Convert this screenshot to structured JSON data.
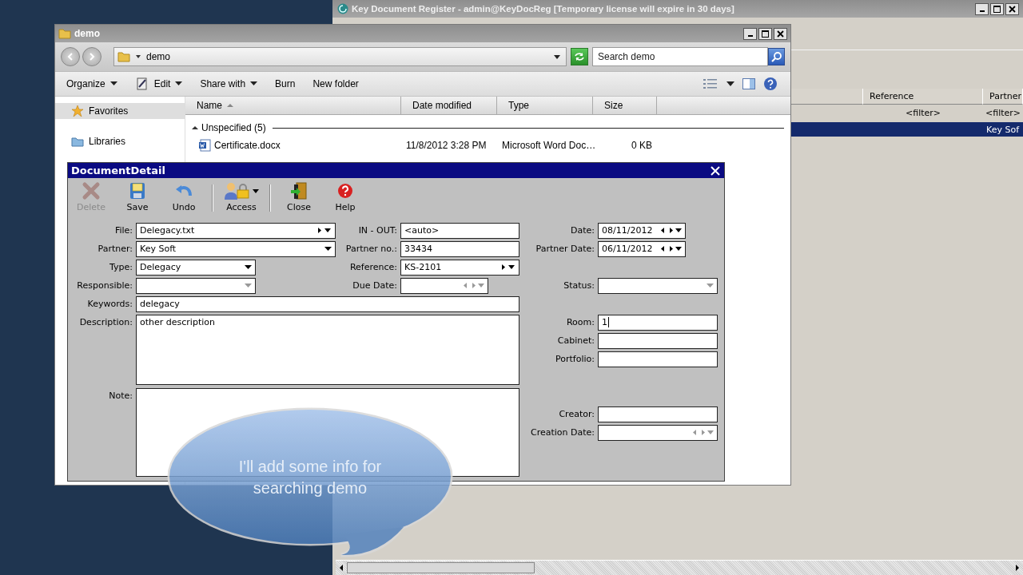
{
  "background_window": {
    "title": "Key Document Register - admin@KeyDocReg [Temporary license will expire in 30 days]",
    "table": {
      "columns": [
        {
          "label": "Reference"
        },
        {
          "label": "Partner"
        }
      ],
      "filters": [
        "<filter>",
        "<filter>"
      ],
      "rows": [
        {
          "partner": "Key Sof",
          "selected": true
        }
      ]
    }
  },
  "explorer": {
    "title": "demo",
    "address": "demo",
    "search": {
      "placeholder": "Search demo"
    },
    "toolbar": [
      {
        "label": "Organize",
        "kind": "menu"
      },
      {
        "label": "Edit",
        "kind": "icon-menu"
      },
      {
        "label": "Share with",
        "kind": "menu"
      },
      {
        "label": "Burn",
        "kind": "command"
      },
      {
        "label": "New folder",
        "kind": "command"
      }
    ],
    "nav": [
      {
        "label": "Favorites",
        "kind": "favorites",
        "selected": true
      },
      {
        "label": "Libraries",
        "kind": "libraries",
        "selected": false
      }
    ],
    "columns": [
      {
        "label": "Name",
        "sorted": true
      },
      {
        "label": "Date modified",
        "sorted": false
      },
      {
        "label": "Type",
        "sorted": false
      },
      {
        "label": "Size",
        "sorted": false
      }
    ],
    "group": {
      "label": "Unspecified (5)",
      "expanded": true
    },
    "files": [
      {
        "name": "Certificate.docx",
        "date": "11/8/2012 3:28 PM",
        "type": "Microsoft Word Doc…",
        "size": "0 KB",
        "selected": false
      }
    ]
  },
  "document_detail": {
    "title": "DocumentDetail",
    "toolbar_groups": [
      [
        {
          "label": "Delete",
          "kind": "delete",
          "disabled": true,
          "has_menu": false
        },
        {
          "label": "Save",
          "kind": "save",
          "disabled": false,
          "has_menu": false
        },
        {
          "label": "Undo",
          "kind": "undo",
          "disabled": false,
          "has_menu": false
        }
      ],
      [
        {
          "label": "Access",
          "kind": "access",
          "disabled": false,
          "has_menu": true
        }
      ],
      [
        {
          "label": "Close",
          "kind": "close",
          "disabled": false,
          "has_menu": false
        },
        {
          "label": "Help",
          "kind": "help",
          "disabled": false,
          "has_menu": false
        }
      ]
    ],
    "left_fields": [
      {
        "label": "File:",
        "kind": "combo-nav",
        "value": "Delegacy.txt",
        "focused": false
      },
      {
        "label": "Partner:",
        "kind": "combo",
        "value": "Key Soft",
        "focused": false
      },
      {
        "label": "Type:",
        "kind": "combo",
        "value": "Delegacy",
        "focused": false
      },
      {
        "label": "Responsible:",
        "kind": "combo",
        "focused": false
      },
      {
        "label": "Keywords:",
        "kind": "text",
        "value": "delegacy",
        "focused": false
      },
      {
        "label": "Description:",
        "kind": "memo",
        "value": "other description",
        "focused": false
      },
      {
        "label": "Note:",
        "kind": "memo",
        "focused": false
      }
    ],
    "middle_fields": [
      {
        "label": "IN - OUT:",
        "kind": "text",
        "value": "<auto>",
        "focused": false
      },
      {
        "label": "Partner no.:",
        "kind": "text",
        "value": "33434",
        "focused": false
      },
      {
        "label": "Reference:",
        "kind": "combo-nav",
        "value": "KS-2101",
        "focused": false
      },
      {
        "label": "Due Date:",
        "kind": "date",
        "focused": false
      }
    ],
    "right_fields": [
      {
        "label": "Date:",
        "kind": "date",
        "value": "08/11/2012",
        "focused": false
      },
      {
        "label": "Partner Date:",
        "kind": "date",
        "value": "06/11/2012",
        "focused": false
      },
      {
        "label": "Status:",
        "kind": "combo",
        "focused": false
      },
      {
        "label": "Room:",
        "kind": "text",
        "value": "1",
        "focused": true
      },
      {
        "label": "Cabinet:",
        "kind": "text",
        "focused": false
      },
      {
        "label": "Portfolio:",
        "kind": "text",
        "focused": false
      },
      {
        "label": "Creator:",
        "kind": "text",
        "focused": false
      },
      {
        "label": "Creation Date:",
        "kind": "date",
        "focused": false
      }
    ]
  },
  "callout": {
    "text": "I'll add some info for searching demo"
  }
}
